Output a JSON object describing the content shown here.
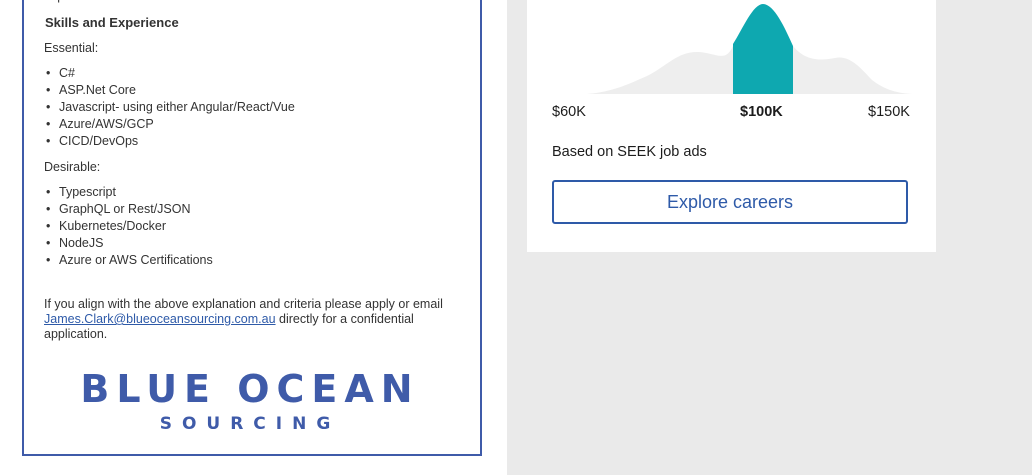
{
  "job_description": {
    "cut_line": "experience",
    "skills_heading": "Skills and Experience",
    "essential_label": "Essential:",
    "essential_items": [
      "C#",
      "ASP.Net Core",
      "Javascript- using either Angular/React/Vue",
      "Azure/AWS/GCP",
      "CICD/DevOps"
    ],
    "desirable_label": "Desirable:",
    "desirable_items": [
      "Typescript",
      "GraphQL or Rest/JSON",
      "Kubernetes/Docker",
      "NodeJS",
      "Azure or AWS Certifications"
    ],
    "closing_before": "If you align with the above explanation and criteria please apply or email ",
    "closing_email": "James.Clark@blueoceansourcing.com.au",
    "closing_after": " directly for a confidential application.",
    "logo_line1": "BLUE OCEAN",
    "logo_line2": "SOURCING"
  },
  "salary_card": {
    "label_low": "$60K",
    "label_mid": "$100K",
    "label_high": "$150K",
    "based_on": "Based on SEEK job ads",
    "explore_button": "Explore careers",
    "colors": {
      "highlight": "#0ea8b0",
      "distribution": "#eeeeee",
      "button": "#2e5aa8"
    }
  }
}
